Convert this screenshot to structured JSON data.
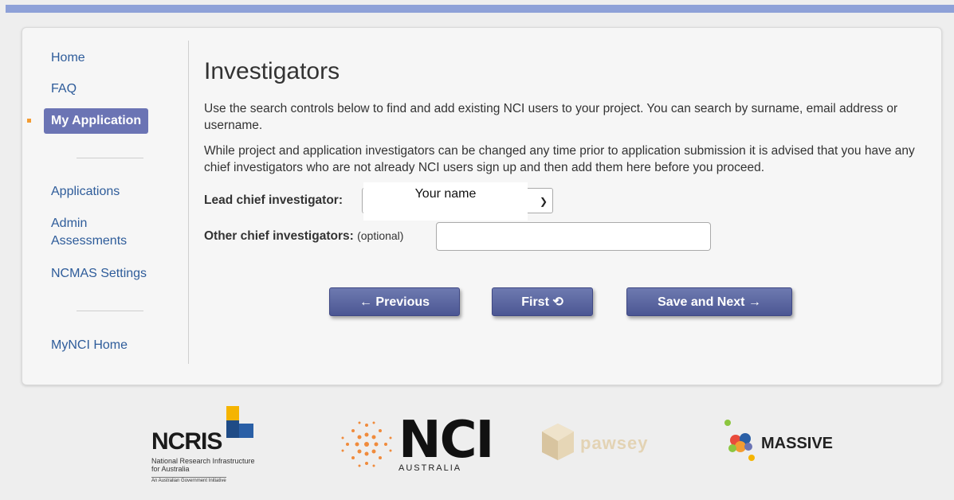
{
  "sidebar": {
    "items": [
      {
        "label": "Home"
      },
      {
        "label": "FAQ"
      },
      {
        "label": "My Application"
      },
      {
        "label": "Applications"
      },
      {
        "label": "Admin Assessments"
      },
      {
        "label": "NCMAS Settings"
      },
      {
        "label": "MyNCI Home"
      }
    ]
  },
  "main": {
    "title": "Investigators",
    "paragraph1": "Use the search controls below to find and add existing NCI users to your project. You can search by surname, email address or username.",
    "paragraph2": "While project and application investigators can be changed any time prior to application submission it is advised that you have any chief investigators who are not already NCI users sign up and then add them here before you proceed.",
    "lead_label": "Lead chief investigator:",
    "lead_value": "Your name",
    "other_label": "Other chief investigators:",
    "other_optional": "(optional)",
    "other_value": ""
  },
  "buttons": {
    "previous": "← Previous",
    "first": "First ⟲",
    "save_next": "Save and Next →"
  },
  "footer": {
    "ncris_name": "NCRIS",
    "ncris_sub": "National Research Infrastructure for Australia",
    "ncris_sub2": "An Australian Government Initiative",
    "nci_name": "NCI",
    "nci_sub": "AUSTRALIA",
    "pawsey_name": "pawsey",
    "massive_name": "MASSIVE"
  },
  "colors": {
    "accent": "#6b74b4",
    "button": "#4b5693",
    "link": "#2e5c9a",
    "bullet": "#f39c33"
  }
}
